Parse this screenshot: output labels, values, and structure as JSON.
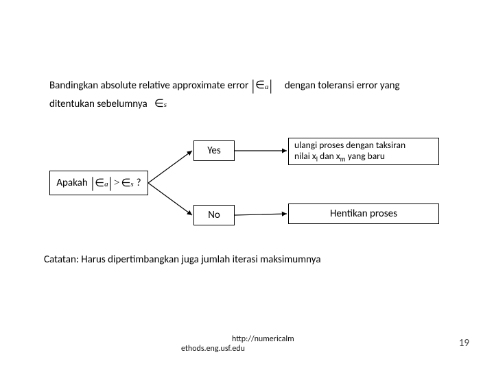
{
  "intro": {
    "part1": "Bandingkan absolute relative approximate error",
    "part2": "dengan toleransi error yang ditentukan sebelumnya"
  },
  "epsilon_a": {
    "sym": "∈",
    "sub": "a"
  },
  "epsilon_s": {
    "sym": "∈",
    "sub": "s"
  },
  "decision": {
    "prefix": "Apakah",
    "gt": ">",
    "suffix": "?"
  },
  "yes": "Yes",
  "no": "No",
  "repeat": {
    "line1": "ulangi proses dengan taksiran",
    "line2_pre": "nilai x",
    "line2_sub1": "l",
    "line2_mid": " dan x",
    "line2_sub2": "m",
    "line2_post": " yang baru"
  },
  "stop": "Hentikan proses",
  "note": "Catatan: Harus dipertimbangkan juga jumlah iterasi maksimumnya",
  "footer": {
    "url": "http://numericalm",
    "ethods": "ethods.eng.usf.edu",
    "page": "19"
  }
}
